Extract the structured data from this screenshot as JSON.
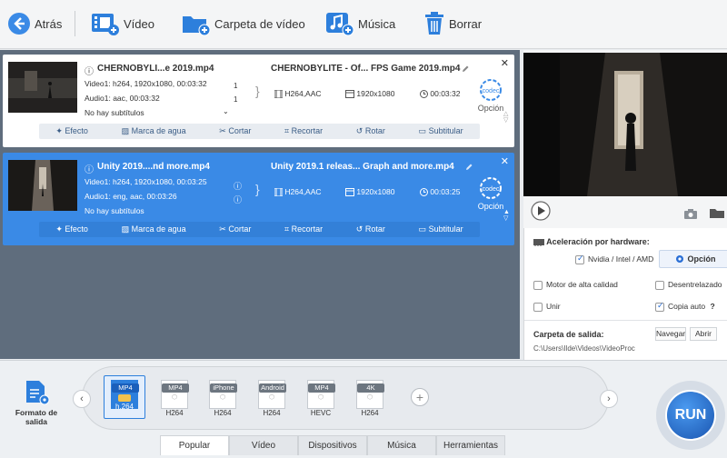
{
  "toolbar": {
    "back_label": "Atrás",
    "video_label": "Vídeo",
    "folder_label": "Carpeta de vídeo",
    "music_label": "Música",
    "delete_label": "Borrar"
  },
  "items": [
    {
      "name": "CHERNOBYLI...e 2019.mp4",
      "video_line": "Video1: h264, 1920x1080, 00:03:32",
      "audio_line": "Audio1: aac, 00:03:32",
      "subtitle_line": "No hay subtítulos",
      "video_track": "1",
      "audio_track": "1",
      "output_name": "CHERNOBYLITE  - Of... FPS Game 2019.mp4",
      "output_codec": "H264,AAC",
      "output_res": "1920x1080",
      "output_dur": "00:03:32",
      "codec_badge": "codec",
      "option_label": "Opción",
      "actions": [
        "Efecto",
        "Marca de agua",
        "Cortar",
        "Recortar",
        "Rotar",
        "Subtitular"
      ]
    },
    {
      "name": "Unity 2019....nd more.mp4",
      "video_line": "Video1: h264, 1920x1080, 00:03:25",
      "audio_line": "Audio1: eng, aac, 00:03:26",
      "subtitle_line": "No hay subtítulos",
      "output_name": "Unity 2019.1 releas... Graph and more.mp4",
      "output_codec": "H264,AAC",
      "output_res": "1920x1080",
      "output_dur": "00:03:25",
      "codec_badge": "codec",
      "option_label": "Opción",
      "actions": [
        "Efecto",
        "Marca de agua",
        "Cortar",
        "Recortar",
        "Rotar",
        "Subtitular"
      ]
    }
  ],
  "hardware": {
    "title": "Aceleración por hardware:",
    "nvidia_label": "Nvidia / Intel / AMD",
    "option_button": "Opción",
    "motor_label": "Motor de alta calidad",
    "deinterlace_label": "Desentrelazado",
    "merge_label": "Unir",
    "autocopy_label": "Copia auto",
    "help": "?",
    "output_folder_label": "Carpeta de salida:",
    "browse_label": "Navegar",
    "open_label": "Abrir",
    "output_path": "C:\\Users\\Ilde\\Videos\\VideoProc"
  },
  "format": {
    "title": "Formato de salida",
    "profiles": [
      {
        "tag": "MP4",
        "cap": "h.264",
        "selected": true
      },
      {
        "tag": "MP4",
        "cap": "H264"
      },
      {
        "tag": "iPhone",
        "cap": "H264"
      },
      {
        "tag": "Android",
        "cap": "H264"
      },
      {
        "tag": "MP4",
        "cap": "HEVC"
      },
      {
        "tag": "4K",
        "cap": "H264"
      }
    ],
    "tabs": [
      "Popular",
      "Vídeo",
      "Dispositivos",
      "Música",
      "Herramientas"
    ],
    "active_tab": "Popular",
    "run_label": "RUN"
  },
  "colors": {
    "accent": "#2a6fd6",
    "selected_item": "#3a8ae6",
    "panel_bg": "#5f6d7d",
    "run_button": "#1f5fb8"
  }
}
